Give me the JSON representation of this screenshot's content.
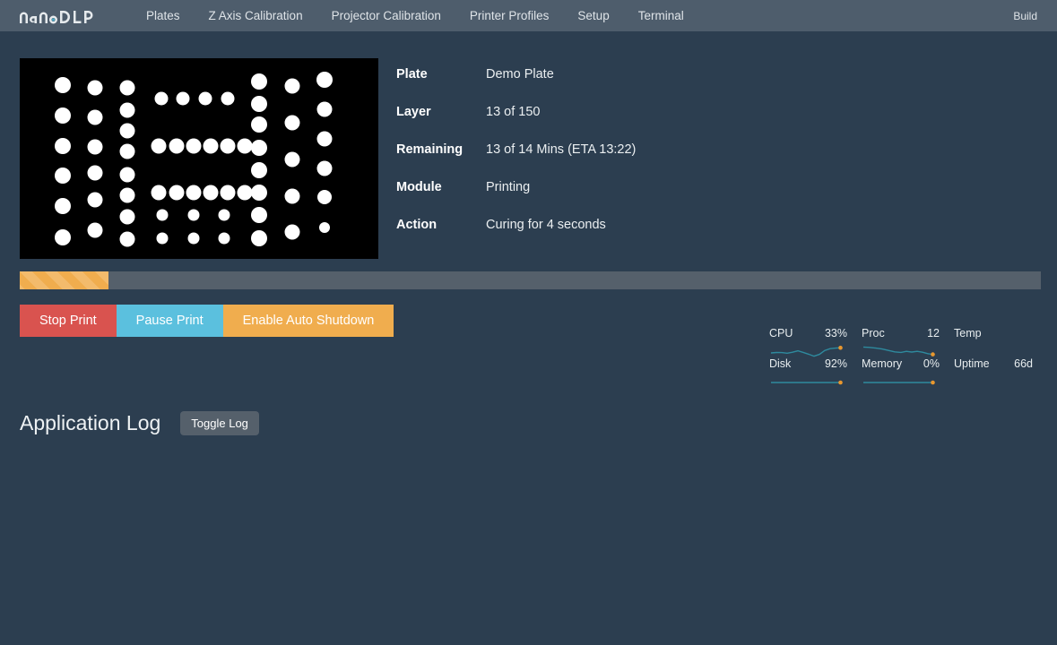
{
  "navbar": {
    "brand": "nanoDLP",
    "brand_icon": "nanodlp-logo",
    "items": [
      {
        "label": "Plates"
      },
      {
        "label": "Z Axis Calibration"
      },
      {
        "label": "Projector Calibration"
      },
      {
        "label": "Printer Profiles"
      },
      {
        "label": "Setup"
      },
      {
        "label": "Terminal"
      }
    ],
    "right_items": [
      {
        "label": "Build"
      }
    ]
  },
  "preview": {
    "alt": "slice-preview",
    "background": "#000000",
    "dot_color": "#ffffff"
  },
  "info": {
    "rows": [
      {
        "label": "Plate",
        "value": "Demo Plate"
      },
      {
        "label": "Layer",
        "value": "13 of 150"
      },
      {
        "label": "Remaining",
        "value": "13 of 14 Mins (ETA 13:22)"
      },
      {
        "label": "Module",
        "value": "Printing"
      },
      {
        "label": "Action",
        "value": "Curing for 4 seconds"
      }
    ]
  },
  "progress": {
    "percent": 8.7,
    "color": "#f0ad4e",
    "track_color": "#55606b"
  },
  "actions": [
    {
      "label": "Stop Print",
      "style": "danger",
      "color": "#d9534f"
    },
    {
      "label": "Pause Print",
      "style": "info",
      "color": "#5bc0de"
    },
    {
      "label": "Enable Auto Shutdown",
      "style": "warning",
      "color": "#f0ad4e"
    }
  ],
  "stats": {
    "line_color": "#2e8a9e",
    "point_color": "#e8972e",
    "cells": [
      {
        "name": "CPU",
        "value": "33%",
        "spark": [
          9,
          8,
          8,
          7,
          7,
          6,
          7,
          9,
          11,
          10,
          12,
          9,
          4,
          6,
          9,
          10,
          11,
          12,
          12
        ]
      },
      {
        "name": "Proc",
        "value": "12",
        "spark": [
          13,
          13,
          12,
          12,
          11,
          10,
          9,
          8,
          7,
          7,
          8,
          7,
          6,
          7,
          8,
          7,
          6,
          5,
          4
        ]
      },
      {
        "name": "Temp",
        "value": "",
        "spark": []
      },
      {
        "name": "Disk",
        "value": "92%",
        "spark": [
          6,
          6,
          6,
          6,
          6,
          6,
          6,
          6,
          6,
          6,
          6,
          6,
          6,
          6,
          6,
          6,
          6,
          6,
          6
        ]
      },
      {
        "name": "Memory",
        "value": "0%",
        "spark": [
          6,
          6,
          6,
          6,
          6,
          6,
          6,
          6,
          6,
          6,
          6,
          6,
          6,
          6,
          6,
          6,
          6,
          6,
          6
        ]
      },
      {
        "name": "Uptime",
        "value": "66d",
        "spark": []
      }
    ]
  },
  "log": {
    "title": "Application Log",
    "toggle_label": "Toggle Log",
    "entries": []
  }
}
